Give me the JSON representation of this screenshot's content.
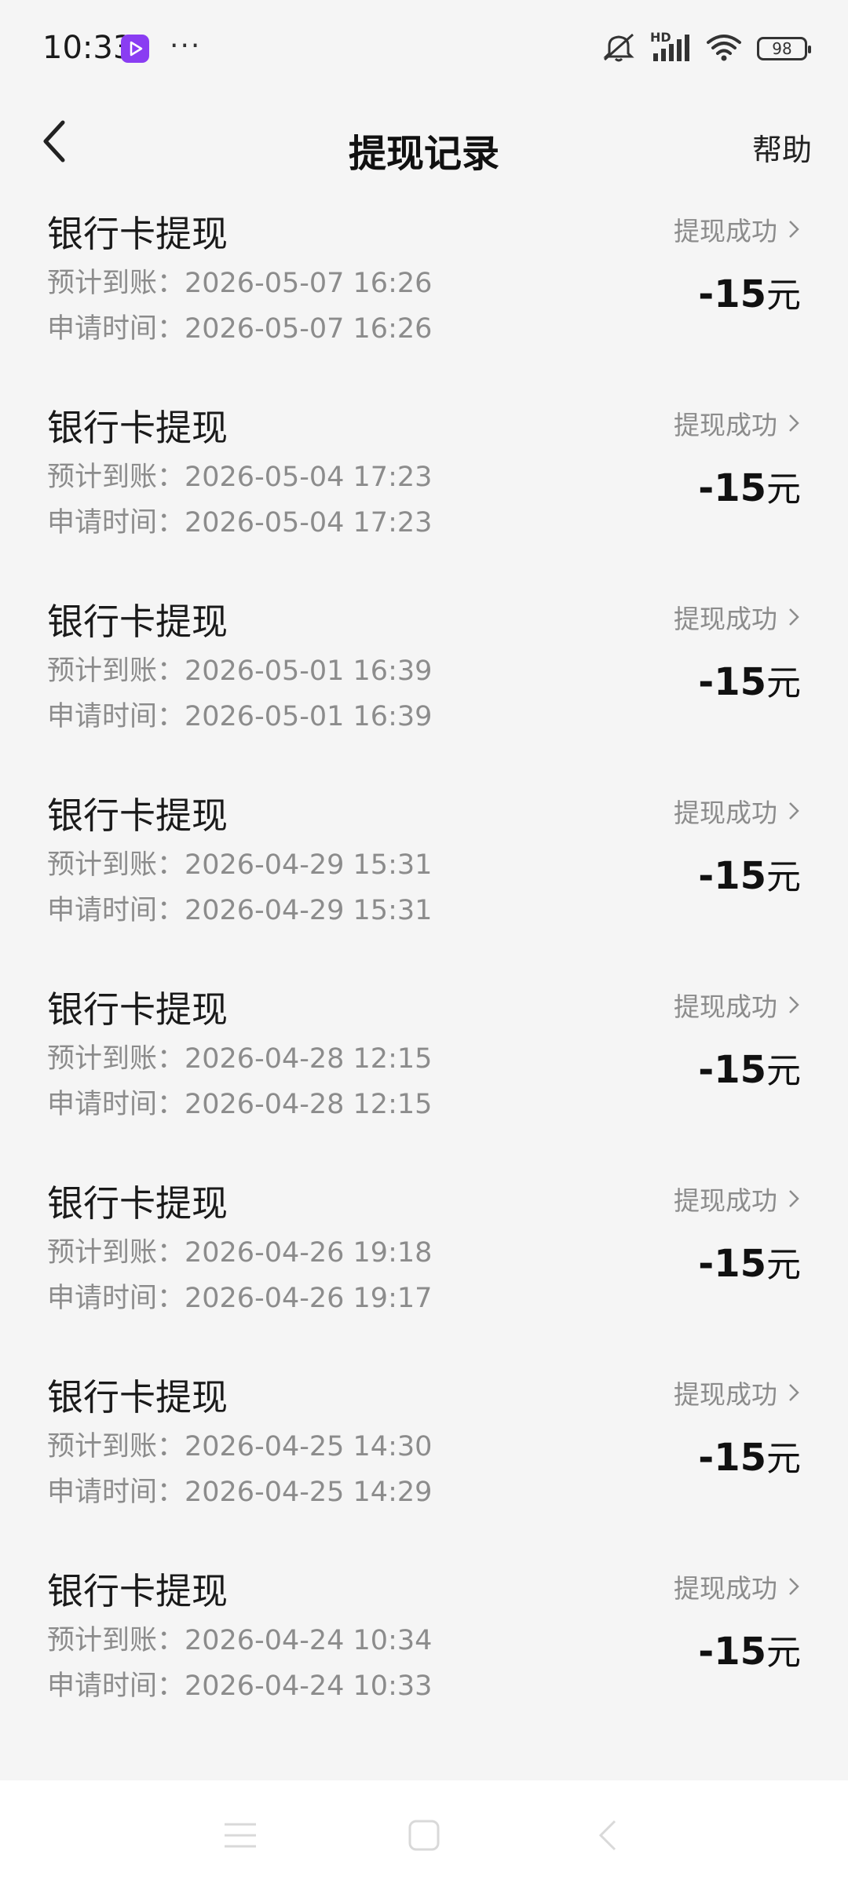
{
  "status_bar": {
    "time": "10:33",
    "icons": [
      "video-app-icon",
      "more-dots-icon",
      "mute-icon",
      "signal-icon",
      "wifi-icon"
    ],
    "more": "···",
    "battery": "98",
    "network": "HD"
  },
  "header": {
    "title": "提现记录",
    "help_label": "帮助"
  },
  "records": [
    {
      "title": "银行卡提现",
      "status": "提现成功",
      "estimated": "预计到账：2026-05-07 16:26",
      "applied": "申请时间：2026-05-07 16:26",
      "amount": "-15",
      "unit": "元"
    },
    {
      "title": "银行卡提现",
      "status": "提现成功",
      "estimated": "预计到账：2026-05-04 17:23",
      "applied": "申请时间：2026-05-04 17:23",
      "amount": "-15",
      "unit": "元"
    },
    {
      "title": "银行卡提现",
      "status": "提现成功",
      "estimated": "预计到账：2026-05-01 16:39",
      "applied": "申请时间：2026-05-01 16:39",
      "amount": "-15",
      "unit": "元"
    },
    {
      "title": "银行卡提现",
      "status": "提现成功",
      "estimated": "预计到账：2026-04-29 15:31",
      "applied": "申请时间：2026-04-29 15:31",
      "amount": "-15",
      "unit": "元"
    },
    {
      "title": "银行卡提现",
      "status": "提现成功",
      "estimated": "预计到账：2026-04-28 12:15",
      "applied": "申请时间：2026-04-28 12:15",
      "amount": "-15",
      "unit": "元"
    },
    {
      "title": "银行卡提现",
      "status": "提现成功",
      "estimated": "预计到账：2026-04-26 19:18",
      "applied": "申请时间：2026-04-26 19:17",
      "amount": "-15",
      "unit": "元"
    },
    {
      "title": "银行卡提现",
      "status": "提现成功",
      "estimated": "预计到账：2026-04-25 14:30",
      "applied": "申请时间：2026-04-25 14:29",
      "amount": "-15",
      "unit": "元"
    },
    {
      "title": "银行卡提现",
      "status": "提现成功",
      "estimated": "预计到账：2026-04-24 10:34",
      "applied": "申请时间：2026-04-24 10:33",
      "amount": "-15",
      "unit": "元"
    }
  ],
  "colors": {
    "background": "#f5f5f5",
    "text_primary": "#1a1a1a",
    "text_secondary": "#8c8c8c",
    "app_badge": "#8a3df2"
  },
  "nav_bar": {
    "icons": [
      "menu-icon",
      "home-icon",
      "back-icon"
    ]
  }
}
